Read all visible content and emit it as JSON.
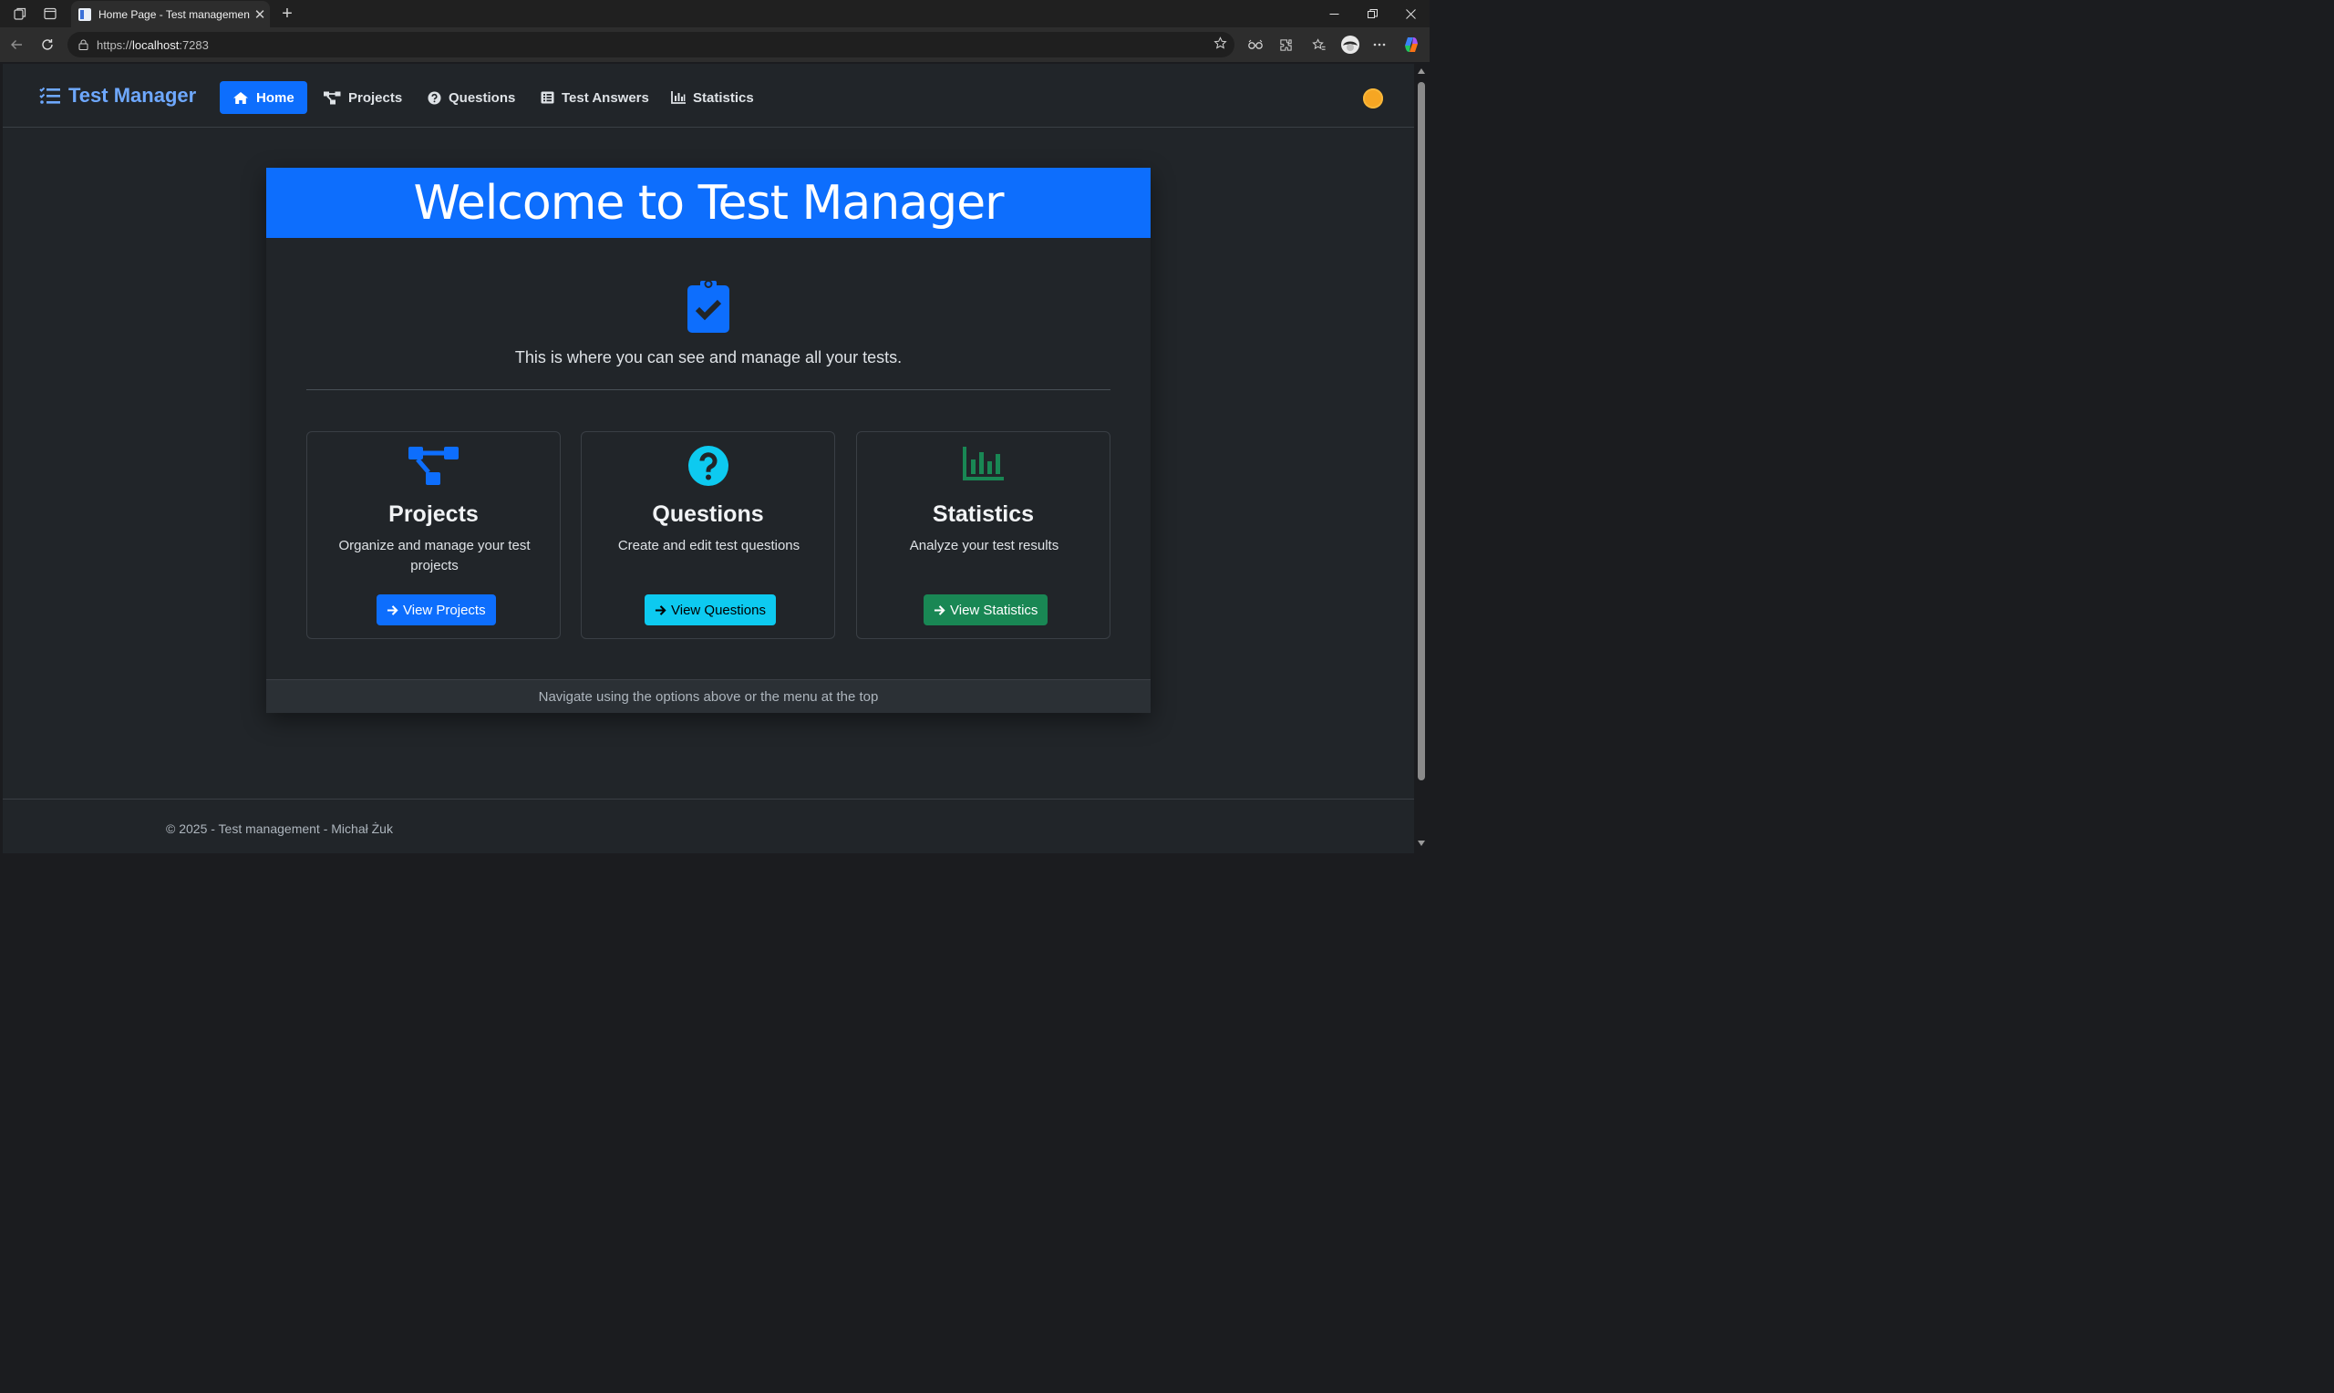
{
  "browser": {
    "tab_title": "Home Page - Test management",
    "tab_close": "✕",
    "new_tab": "+",
    "url_scheme": "https://",
    "url_host": "localhost",
    "url_port": ":7283"
  },
  "navbar": {
    "brand": "Test Manager",
    "items": [
      {
        "label": "Home",
        "icon": "home-icon",
        "active": true
      },
      {
        "label": "Projects",
        "icon": "project-diagram-icon"
      },
      {
        "label": "Questions",
        "icon": "question-circle-icon"
      },
      {
        "label": "Test Answers",
        "icon": "list-alt-icon"
      },
      {
        "label": "Statistics",
        "icon": "chart-bar-icon"
      }
    ],
    "theme_toggle_icon": "sun-icon"
  },
  "hero": {
    "title": "Welcome to Test Manager",
    "icon": "clipboard-check-icon",
    "lead": "This is where you can see and manage all your tests."
  },
  "features": [
    {
      "title": "Projects",
      "description": "Organize and manage your test projects",
      "button": "View Projects",
      "icon": "project-diagram-icon",
      "color": "#0d6efd"
    },
    {
      "title": "Questions",
      "description": "Create and edit test questions",
      "button": "View Questions",
      "icon": "question-circle-icon",
      "color": "#0dcaf0"
    },
    {
      "title": "Statistics",
      "description": "Analyze your test results",
      "button": "View Statistics",
      "icon": "chart-bar-icon",
      "color": "#198754"
    }
  ],
  "card_footer": "Navigate using the options above or the menu at the top",
  "footer": "© 2025 - Test management - Michał Żuk",
  "colors": {
    "primary": "#0d6efd",
    "info": "#0dcaf0",
    "success": "#198754",
    "background": "#212529"
  }
}
